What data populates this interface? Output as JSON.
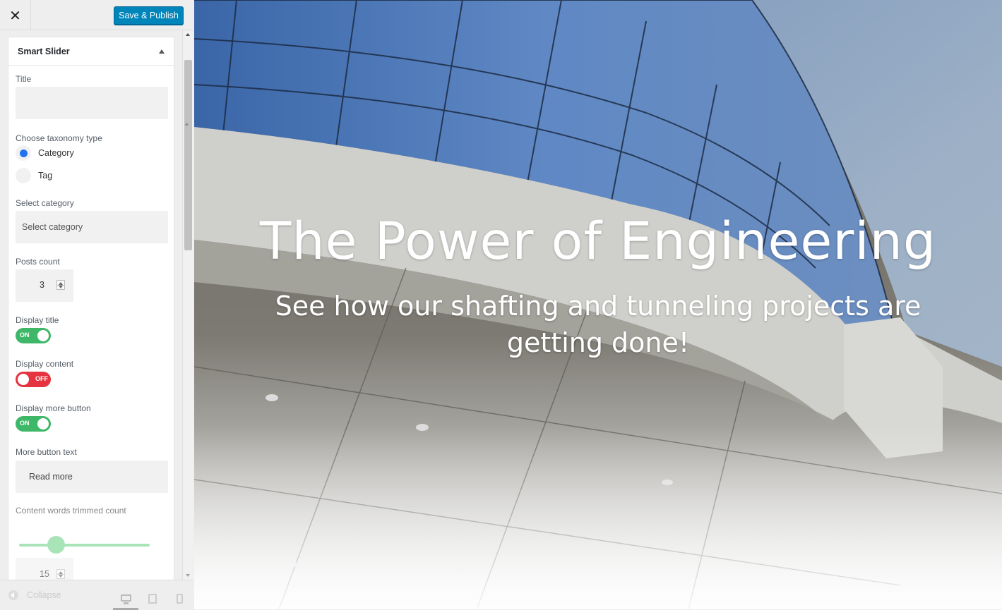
{
  "header": {
    "close_icon": "close-icon",
    "publish_label": "Save & Publish"
  },
  "section": {
    "title": "Smart Slider"
  },
  "fields": {
    "title_label": "Title",
    "title_value": "",
    "taxonomy_label": "Choose taxonomy type",
    "taxonomy_options": [
      "Category",
      "Tag"
    ],
    "taxonomy_selected": "Category",
    "category_label": "Select category",
    "category_placeholder": "Select category",
    "posts_count_label": "Posts count",
    "posts_count_value": "3",
    "display_title_label": "Display title",
    "display_title_state": "ON",
    "display_content_label": "Display content",
    "display_content_state": "OFF",
    "display_more_label": "Display more button",
    "display_more_state": "ON",
    "more_text_label": "More button text",
    "more_text_value": "Read more",
    "trim_label": "Content words trimmed count",
    "trim_value": "15"
  },
  "footer": {
    "collapse_label": "Collapse",
    "devices": [
      "desktop",
      "tablet",
      "mobile"
    ],
    "active_device": "desktop"
  },
  "preview": {
    "title": "The Power of Engineering",
    "subtitle": "See how our shafting and tunneling projects are getting done!"
  },
  "colors": {
    "publish": "#0085ba",
    "toggle_on": "#3fb768",
    "toggle_off": "#e5333f",
    "radio": "#2271ee"
  }
}
